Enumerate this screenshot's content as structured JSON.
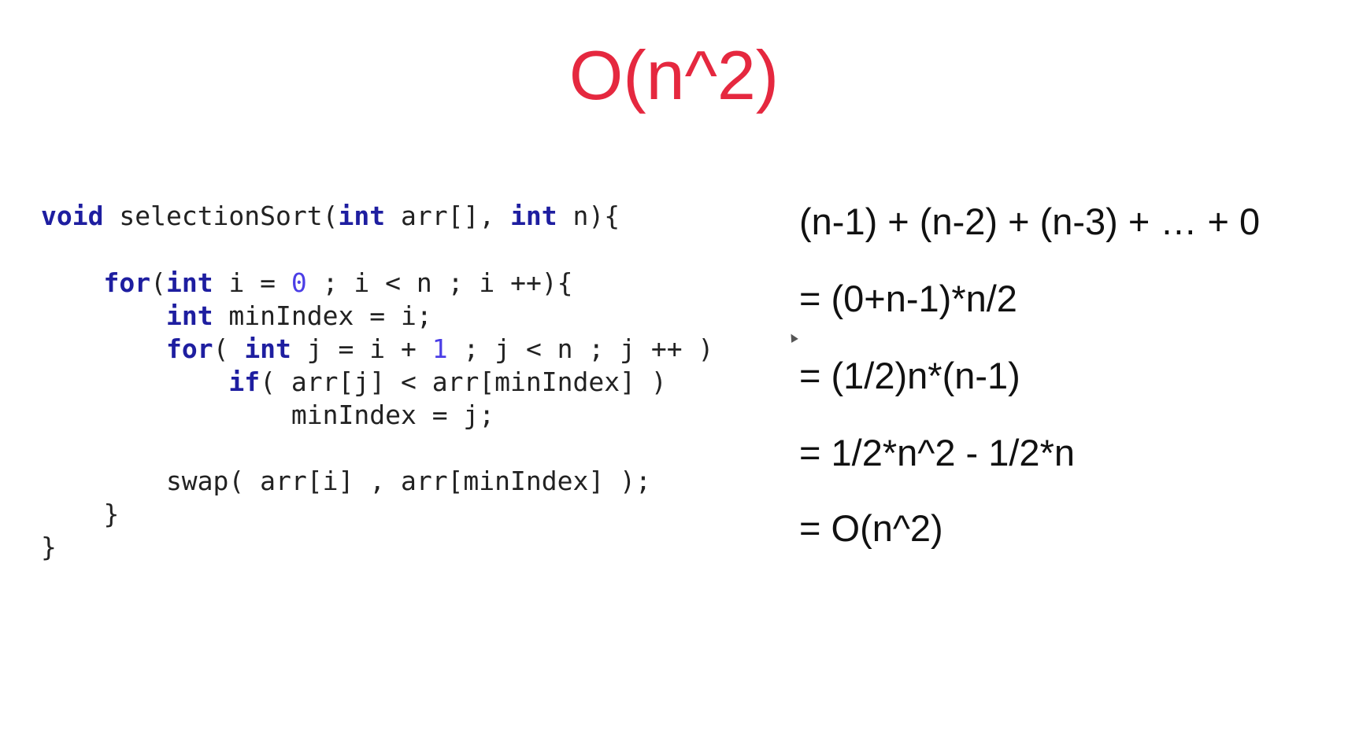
{
  "title": "O(n^2)",
  "code": {
    "line1": {
      "kw_void": "void",
      "t1": " selectionSort(",
      "kw_int1": "int",
      "t2": " arr[], ",
      "kw_int2": "int",
      "t3": " n){"
    },
    "line2": {
      "indent": "    ",
      "kw_for": "for",
      "t1": "(",
      "kw_int": "int",
      "t2": " i = ",
      "num": "0",
      "t3": " ; i < n ; i ++){"
    },
    "line3": {
      "indent": "        ",
      "kw_int": "int",
      "t1": " minIndex = i;"
    },
    "line4": {
      "indent": "        ",
      "kw_for": "for",
      "t1": "( ",
      "kw_int": "int",
      "t2": " j = i + ",
      "num": "1",
      "t3": " ; j < n ; j ++ )"
    },
    "line5": {
      "indent": "            ",
      "kw_if": "if",
      "t1": "( arr[j] < arr[minIndex] )"
    },
    "line6": {
      "text": "                minIndex = j;"
    },
    "line7": {
      "text": "        swap( arr[i] , arr[minIndex] );"
    },
    "line8": {
      "text": "    }"
    },
    "line9": {
      "text": "}"
    }
  },
  "math": {
    "line1": "(n-1) + (n-2) + (n-3) + … + 0",
    "line2": "= (0+n-1)*n/2",
    "line3": "= (1/2)n*(n-1)",
    "line4": "= 1/2*n^2 - 1/2*n",
    "line5": "= O(n^2)"
  }
}
